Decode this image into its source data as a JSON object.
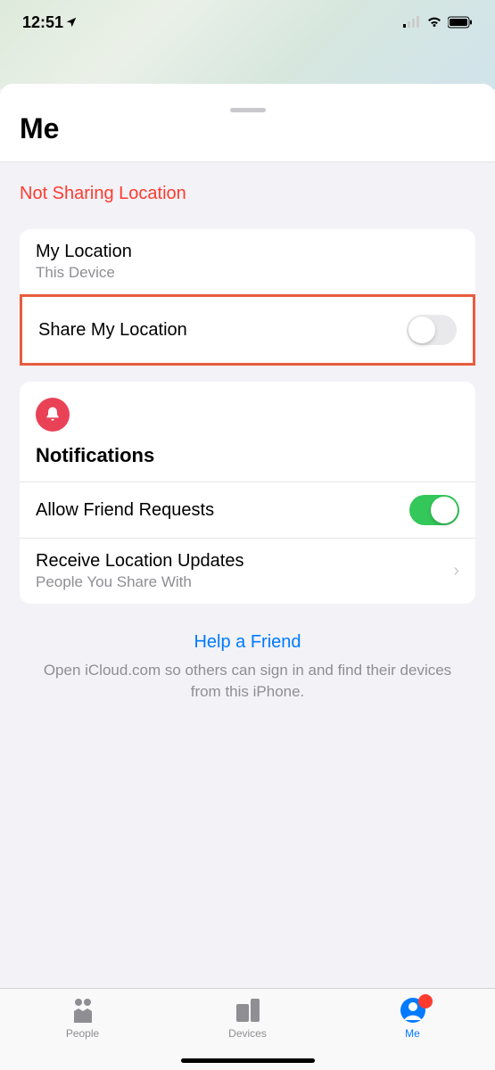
{
  "statusBar": {
    "time": "12:51"
  },
  "sheet": {
    "title": "Me",
    "sharingStatus": "Not Sharing Location"
  },
  "locationCard": {
    "myLocation": {
      "title": "My Location",
      "subtitle": "This Device"
    },
    "shareLocation": {
      "title": "Share My Location",
      "enabled": false
    }
  },
  "notificationsCard": {
    "header": "Notifications",
    "allowRequests": {
      "title": "Allow Friend Requests",
      "enabled": true
    },
    "receiveUpdates": {
      "title": "Receive Location Updates",
      "subtitle": "People You Share With"
    }
  },
  "help": {
    "link": "Help a Friend",
    "text": "Open iCloud.com so others can sign in and find their devices from this iPhone."
  },
  "tabs": {
    "people": "People",
    "devices": "Devices",
    "me": "Me"
  }
}
